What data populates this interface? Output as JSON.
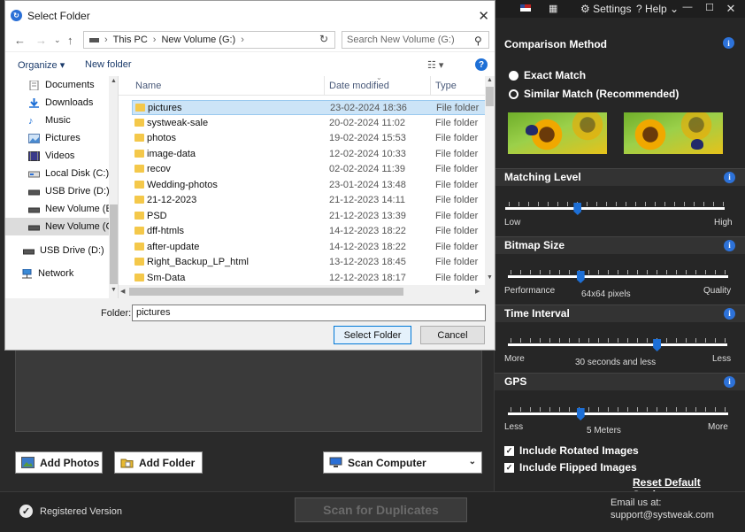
{
  "app": {
    "topbar": {
      "language_flag": "us-flag-icon",
      "settings_label": "Settings",
      "help_label": "Help"
    },
    "left": {
      "add_photos_label": "Add Photos",
      "add_folder_label": "Add Folder",
      "scan_computer_label": "Scan Computer"
    },
    "bottom": {
      "registered_label": "Registered Version",
      "scan_label": "Scan for Duplicates",
      "email_line1": "Email us at:",
      "email_line2": "support@systweak.com"
    },
    "settings": {
      "comparison_title": "Comparison Method",
      "exact_match": "Exact Match",
      "similar_match": "Similar Match (Recommended)",
      "selected_method": "similar_match",
      "matching_title": "Matching Level",
      "matching_low": "Low",
      "matching_high": "High",
      "matching_level": 0.33,
      "bitmap_title": "Bitmap Size",
      "bitmap_left": "Performance",
      "bitmap_right": "Quality",
      "bitmap_value": "64x64 pixels",
      "bitmap_level": 0.33,
      "time_title": "Time Interval",
      "time_left": "More",
      "time_right": "Less",
      "time_value": "30 seconds and less",
      "time_level": 0.68,
      "gps_title": "GPS",
      "gps_left": "Less",
      "gps_right": "More",
      "gps_value": "5 Meters",
      "gps_level": 0.33,
      "rotated_label": "Include Rotated Images",
      "rotated_checked": true,
      "flipped_label": "Include Flipped Images",
      "flipped_checked": true,
      "reset_label": "Reset Default Settings"
    }
  },
  "dialog": {
    "title": "Select Folder",
    "breadcrumb": [
      "This PC",
      "New Volume (G:)"
    ],
    "search_placeholder": "Search New Volume (G:)",
    "organize_label": "Organize",
    "new_folder_label": "New folder",
    "tree": [
      {
        "label": "Documents",
        "icon": "documents-icon"
      },
      {
        "label": "Downloads",
        "icon": "downloads-icon"
      },
      {
        "label": "Music",
        "icon": "music-icon"
      },
      {
        "label": "Pictures",
        "icon": "pictures-icon"
      },
      {
        "label": "Videos",
        "icon": "videos-icon"
      },
      {
        "label": "Local Disk (C:)",
        "icon": "disk-icon"
      },
      {
        "label": "USB Drive (D:)",
        "icon": "usb-drive-icon"
      },
      {
        "label": "New Volume (E:)",
        "icon": "disk-icon"
      },
      {
        "label": "New Volume (G:)",
        "icon": "disk-icon",
        "selected": true
      },
      {
        "label": "USB Drive (D:)",
        "icon": "usb-drive-icon"
      },
      {
        "label": "Network",
        "icon": "network-icon"
      }
    ],
    "columns": [
      "Name",
      "Date modified",
      "Type"
    ],
    "files": [
      {
        "name": "pictures",
        "date": "23-02-2024 18:36",
        "type": "File folder",
        "selected": true
      },
      {
        "name": "systweak-sale",
        "date": "20-02-2024 11:02",
        "type": "File folder"
      },
      {
        "name": "photos",
        "date": "19-02-2024 15:53",
        "type": "File folder"
      },
      {
        "name": "image-data",
        "date": "12-02-2024 10:33",
        "type": "File folder"
      },
      {
        "name": "recov",
        "date": "02-02-2024 11:39",
        "type": "File folder"
      },
      {
        "name": "Wedding-photos",
        "date": "23-01-2024 13:48",
        "type": "File folder"
      },
      {
        "name": "21-12-2023",
        "date": "21-12-2023 14:11",
        "type": "File folder"
      },
      {
        "name": "PSD",
        "date": "21-12-2023 13:39",
        "type": "File folder"
      },
      {
        "name": "dff-htmls",
        "date": "14-12-2023 18:22",
        "type": "File folder"
      },
      {
        "name": "after-update",
        "date": "14-12-2023 18:22",
        "type": "File folder"
      },
      {
        "name": "Right_Backup_LP_html",
        "date": "13-12-2023 18:45",
        "type": "File folder"
      },
      {
        "name": "Sm-Data",
        "date": "12-12-2023 18:17",
        "type": "File folder"
      }
    ],
    "folder_label": "Folder:",
    "folder_value": "pictures",
    "select_label": "Select Folder",
    "cancel_label": "Cancel"
  }
}
